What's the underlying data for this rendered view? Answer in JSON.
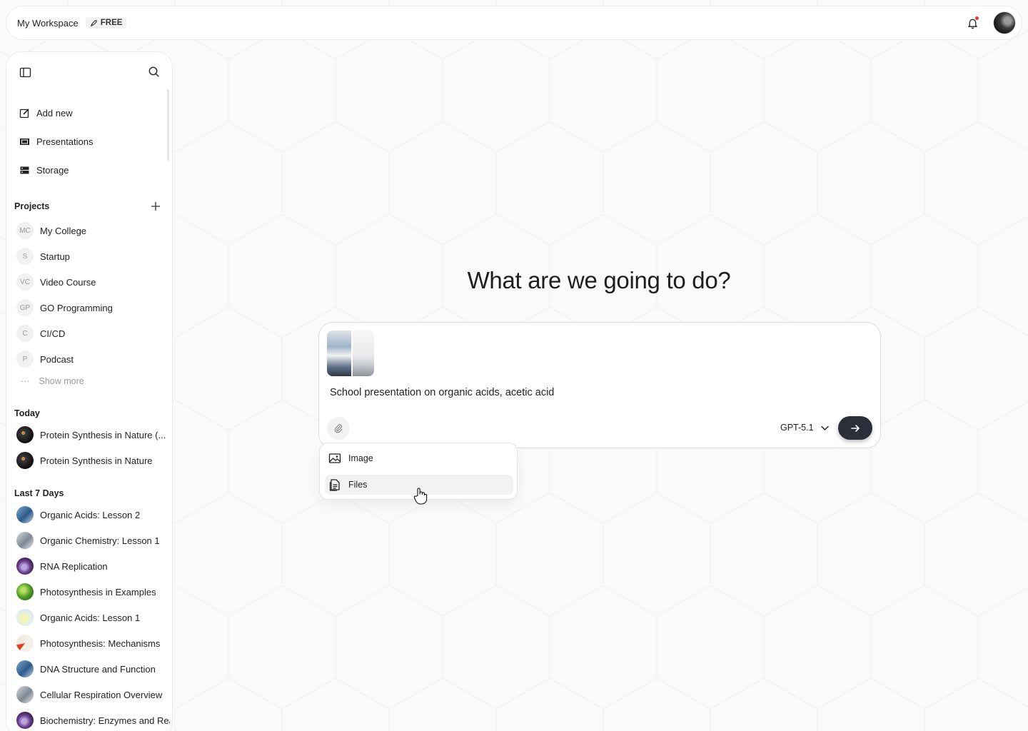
{
  "header": {
    "workspace_title": "My Workspace",
    "plan_badge": "FREE",
    "icons": [
      "bell-icon",
      "avatar"
    ],
    "notification_dot_color": "#e23b3b"
  },
  "sidebar": {
    "nav": [
      {
        "label": "Add new",
        "icon": "edit-icon"
      },
      {
        "label": "Presentations",
        "icon": "presentation-icon"
      },
      {
        "label": "Storage",
        "icon": "storage-icon"
      }
    ],
    "projects_title": "Projects",
    "projects": [
      {
        "initials": "MC",
        "label": "My College"
      },
      {
        "initials": "S",
        "label": "Startup"
      },
      {
        "initials": "VC",
        "label": "Video Course"
      },
      {
        "initials": "GP",
        "label": "GO Programming"
      },
      {
        "initials": "C",
        "label": "CI/CD"
      },
      {
        "initials": "P",
        "label": "Podcast"
      }
    ],
    "show_more": "Show more",
    "today_title": "Today",
    "today": [
      {
        "label": "Protein Synthesis in Nature (..."
      },
      {
        "label": "Protein Synthesis in Nature"
      }
    ],
    "last7_title": "Last 7 Days",
    "last7": [
      {
        "label": "Organic Acids: Lesson 2"
      },
      {
        "label": "Organic Chemistry: Lesson 1"
      },
      {
        "label": "RNA Replication"
      },
      {
        "label": "Photosynthesis in Examples"
      },
      {
        "label": "Organic Acids: Lesson 1"
      },
      {
        "label": "Photosynthesis: Mechanisms"
      },
      {
        "label": "DNA Structure and Function"
      },
      {
        "label": "Cellular Respiration Overview"
      },
      {
        "label": "Biochemistry: Enzymes and Rea"
      }
    ]
  },
  "main": {
    "headline": "What are we going to do?",
    "prompt_text": "School presentation on organic acids, acetic acid",
    "model": "GPT-5.1",
    "send_color": "#2a2f3a"
  },
  "attach_menu": {
    "items": [
      {
        "label": "Image",
        "icon": "image-icon"
      },
      {
        "label": "Files",
        "icon": "file-icon"
      }
    ]
  }
}
